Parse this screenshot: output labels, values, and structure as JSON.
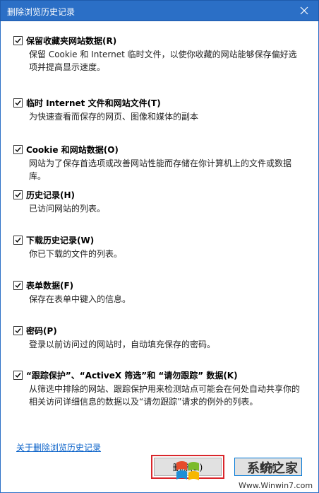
{
  "window": {
    "title": "删除浏览历史记录"
  },
  "options": [
    {
      "checked": true,
      "title": "保留收藏夹网站数据(R)",
      "desc": "保留 Cookie 和 Internet 临时文件，以使你收藏的网站能够保存偏好选项并提高显示速度。"
    },
    {
      "checked": true,
      "title": "临时 Internet 文件和网站文件(T)",
      "desc": "为快速查看而保存的网页、图像和媒体的副本"
    },
    {
      "checked": true,
      "title": "Cookie 和网站数据(O)",
      "desc": "网站为了保存首选项或改善网站性能而存储在你计算机上的文件或数据库。"
    },
    {
      "checked": true,
      "title": "历史记录(H)",
      "desc": "已访问网站的列表。"
    },
    {
      "checked": true,
      "title": "下载历史记录(W)",
      "desc": "你已下载的文件的列表。"
    },
    {
      "checked": true,
      "title": "表单数据(F)",
      "desc": "保存在表单中键入的信息。"
    },
    {
      "checked": true,
      "title": "密码(P)",
      "desc": "登录以前访问过的网站时，自动填充保存的密码。"
    },
    {
      "checked": true,
      "title": "“跟踪保护”、“ActiveX 筛选”和 “请勿跟踪” 数据(K)",
      "desc": "从筛选中排除的网站、跟踪保护用来检测站点可能会在何处自动共享你的相关访问详细信息的数据以及“请勿跟踪”请求的例外的列表。"
    }
  ],
  "footer": {
    "about_link": "关于删除浏览历史记录",
    "delete_label": "删除(D)",
    "cancel_label": "取消"
  },
  "watermark": {
    "name": "系统之家",
    "url": "Www.Winwin7.com"
  },
  "colors": {
    "title_bar": "#2b6fc6",
    "link": "#0a62c9",
    "highlight": "#d9262b"
  }
}
